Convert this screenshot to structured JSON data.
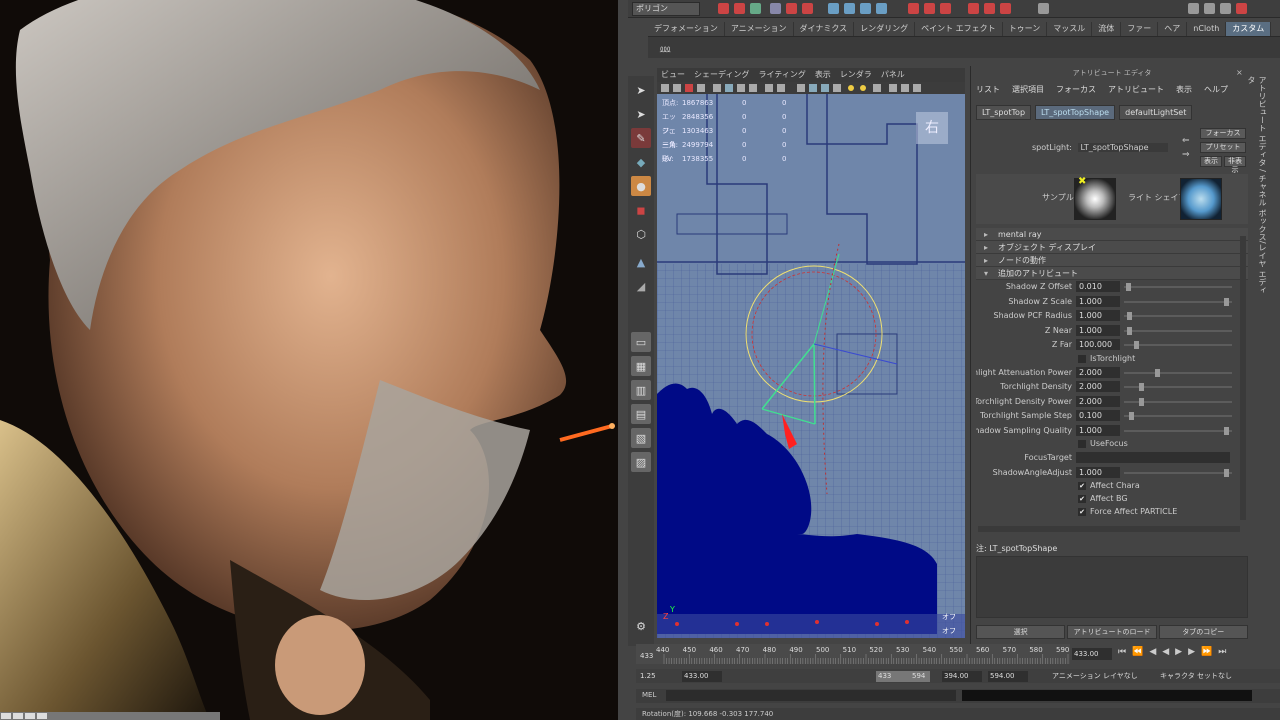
{
  "render_view": {
    "icon_names": [
      "render-taskbar-icon"
    ]
  },
  "top": {
    "menuset": "ポリゴン",
    "shelf_tabs": [
      {
        "label": "デフォメーション",
        "active": false
      },
      {
        "label": "アニメーション",
        "active": false
      },
      {
        "label": "ダイナミクス",
        "active": false
      },
      {
        "label": "レンダリング",
        "active": false
      },
      {
        "label": "ペイント エフェクト",
        "active": false
      },
      {
        "label": "トゥーン",
        "active": false
      },
      {
        "label": "マッスル",
        "active": false
      },
      {
        "label": "流体",
        "active": false
      },
      {
        "label": "ファー",
        "active": false
      },
      {
        "label": "ヘア",
        "active": false
      },
      {
        "label": "nCloth",
        "active": false
      },
      {
        "label": "カスタム",
        "active": true
      }
    ]
  },
  "viewport": {
    "menu": [
      "ビュー",
      "シェーディング",
      "ライティング",
      "表示",
      "レンダラ",
      "パネル"
    ],
    "hud": [
      {
        "label": "頂点:",
        "value": "1867863",
        "sel": "0",
        "extra": "0"
      },
      {
        "label": "エッジ:",
        "value": "2848356",
        "sel": "0",
        "extra": "0"
      },
      {
        "label": "フェース:",
        "value": "1303463",
        "sel": "0",
        "extra": "0"
      },
      {
        "label": "三角形:",
        "value": "2499794",
        "sel": "0",
        "extra": "0"
      },
      {
        "label": "UV:",
        "value": "1738355",
        "sel": "0",
        "extra": "0"
      }
    ],
    "view_label": "右",
    "corner_labels": [
      "オフ",
      "オフ"
    ]
  },
  "attribute_editor": {
    "title": "アトリビュート エディタ",
    "menu": [
      "リスト",
      "選択項目",
      "フォーカス",
      "アトリビュート",
      "表示",
      "ヘルプ"
    ],
    "tabs": [
      {
        "label": "LT_spotTop",
        "active": false
      },
      {
        "label": "LT_spotTopShape",
        "active": true
      },
      {
        "label": "defaultLightSet",
        "active": false
      }
    ],
    "node_type": "spotLight:",
    "node_name": "LT_spotTopShape",
    "focus_btn": "フォーカス",
    "preset_btn": "プリセット",
    "show_btn": "表示",
    "hide_btn": "非表示",
    "sample_label": "サンプル",
    "light_shape_label": "ライト シェイプ",
    "sections": [
      {
        "label": "mental ray",
        "open": false
      },
      {
        "label": "オブジェクト ディスプレイ",
        "open": false
      },
      {
        "label": "ノードの動作",
        "open": false
      },
      {
        "label": "追加のアトリビュート",
        "open": true
      }
    ],
    "attrs": [
      {
        "label": "Shadow Z Offset",
        "value": "0.010",
        "level": 0.02
      },
      {
        "label": "Shadow Z Scale",
        "value": "1.000",
        "level": 0.97
      },
      {
        "label": "Shadow PCF Radius",
        "value": "1.000",
        "level": 0.03
      },
      {
        "label": "Z Near",
        "value": "1.000",
        "level": 0.03
      },
      {
        "label": "Z Far",
        "value": "100.000",
        "level": 0.1
      }
    ],
    "check_torchlight": {
      "label": "IsTorchlight",
      "checked": false
    },
    "attrs2": [
      {
        "label": "Torchlight Attenuation Power",
        "value": "2.000",
        "level": 0.3
      },
      {
        "label": "Torchlight Density",
        "value": "2.000",
        "level": 0.15
      },
      {
        "label": "Torchlight Density Power",
        "value": "2.000",
        "level": 0.15
      },
      {
        "label": "Torchlight Sample Step",
        "value": "0.100",
        "level": 0.05
      },
      {
        "label": "Shadow Sampling Quality",
        "value": "1.000",
        "level": 0.97
      }
    ],
    "check_usefocus": {
      "label": "UseFocus",
      "checked": false
    },
    "focus_target_label": "FocusTarget",
    "shadow_angle": {
      "label": "ShadowAngleAdjust",
      "value": "1.000",
      "level": 0.97
    },
    "checks": [
      {
        "label": "Affect Chara",
        "checked": true
      },
      {
        "label": "Affect BG",
        "checked": true
      },
      {
        "label": "Force Affect PARTICLE",
        "checked": true
      }
    ],
    "notes_title": "注: LT_spotTopShape",
    "bottom_buttons": [
      "選択",
      "アトリビュートのロード",
      "タブのコピー"
    ],
    "side_tabs": "アトリビュート エディタ / チャネル ボックス/レイヤ エディタ"
  },
  "timeline": {
    "ticks": [
      "440",
      "450",
      "460",
      "470",
      "480",
      "490",
      "500",
      "510",
      "520",
      "530",
      "540",
      "550",
      "560",
      "570",
      "580",
      "590"
    ],
    "start_mark": "433",
    "current_time": "433.00",
    "range_start": "1.25",
    "range_inner_start": "433.00",
    "range_slider_start": "433",
    "range_slider_end": "594",
    "range_inner_end": "394.00",
    "range_end": "594.00",
    "anim_layer": "アニメーション レイヤなし",
    "char_set": "キャラクタ セットなし",
    "cmd_label": "MEL",
    "help_text": "Rotation(度):    109.668    -0.303    177.740"
  }
}
